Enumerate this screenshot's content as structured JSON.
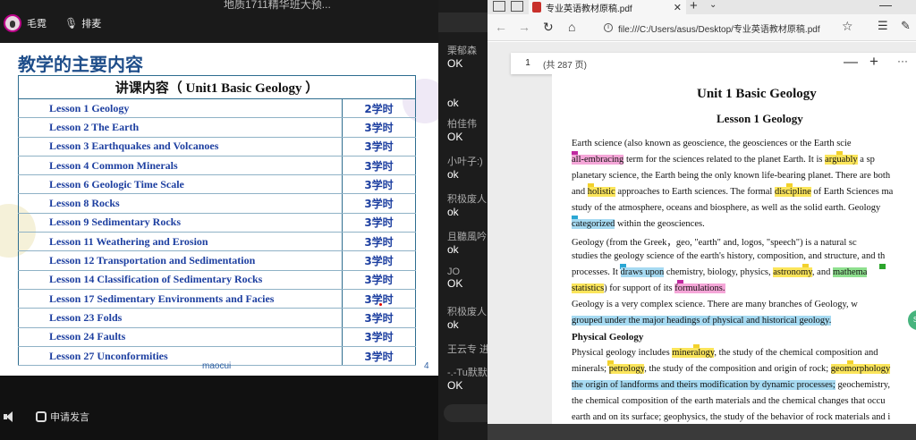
{
  "meeting": {
    "window_title": "地质1711精华班大预...",
    "host_name": "毛霓",
    "seat_label": "排麦",
    "bottom": {
      "apply_label": "申请发言"
    }
  },
  "slide": {
    "title": "教学的主要内容",
    "table_header": "讲课内容（ Unit1  Basic Geology  ）",
    "rows": [
      {
        "lesson": "Lesson 1   Geology",
        "hours": "2学时"
      },
      {
        "lesson": "Lesson 2   The Earth",
        "hours": "3学时"
      },
      {
        "lesson": "Lesson 3   Earthquakes and Volcanoes",
        "hours": "3学时"
      },
      {
        "lesson": "Lesson 4   Common Minerals",
        "hours": "3学时"
      },
      {
        "lesson": "Lesson 6   Geologic Time Scale",
        "hours": "3学时"
      },
      {
        "lesson": "Lesson 8   Rocks",
        "hours": "3学时"
      },
      {
        "lesson": "Lesson 9   Sedimentary Rocks",
        "hours": "3学时"
      },
      {
        "lesson": "Lesson 11 Weathering and Erosion",
        "hours": "3学时"
      },
      {
        "lesson": "Lesson 12  Transportation and Sedimentation",
        "hours": "3学时"
      },
      {
        "lesson": "Lesson 14  Classification of Sedimentary Rocks",
        "hours": "3学时"
      },
      {
        "lesson": "Lesson 17  Sedimentary Environments and Facies",
        "hours": "3学时"
      },
      {
        "lesson": "Lesson 23  Folds",
        "hours": "3学时"
      },
      {
        "lesson": "Lesson 24  Faults",
        "hours": "3学时"
      },
      {
        "lesson": "Lesson 27  Unconformities",
        "hours": "3学时"
      }
    ],
    "footer": "maocui",
    "page": "4"
  },
  "chat": [
    {
      "name": "栗郁森",
      "msg": "OK"
    },
    {
      "name": "",
      "msg": "ok"
    },
    {
      "name": "柏佳伟",
      "msg": "OK"
    },
    {
      "name": "小叶子:)",
      "msg": "ok"
    },
    {
      "name": "积极废人",
      "msg": "ok"
    },
    {
      "name": "且聽風吟",
      "msg": "ok"
    },
    {
      "name": "JO",
      "msg": "OK"
    },
    {
      "name": "积极废人",
      "msg": "ok"
    },
    {
      "name": "王云专 进",
      "msg": ""
    },
    {
      "name": "-.-Tu默默",
      "msg": "OK"
    }
  ],
  "browser": {
    "tab_title": "专业英语教材原稿.pdf",
    "url": "file:///C:/Users/asus/Desktop/专业英语教材原稿.pdf",
    "pdf_page": "1",
    "pdf_total": "(共 287 页)"
  },
  "doc": {
    "h1": "Unit 1    Basic Geology",
    "h2": "Lesson 1    Geology",
    "physical_heading": "Physical Geology",
    "l01": "      Earth science (also known as geoscience, the geosciences or the Earth scie",
    "l02a": "all-embracing",
    "l02b": " term for the sciences related to the planet Earth. It is ",
    "l02c": "arguably",
    "l02d": " a sp",
    "l03": "planetary science, the Earth being the only known life-bearing planet. There are both",
    "l04a": "and ",
    "l04b": "holistic",
    "l04c": " approaches to Earth sciences. The formal ",
    "l04d": "discipline",
    "l04e": " of Earth Sciences ma",
    "l05": "study of the atmosphere, oceans and biosphere, as well as the solid earth. Geology",
    "l06a": "categorized",
    "l06b": " within the geosciences.",
    "l07": "      Geology (from the Greek，geo, \"earth\" and, logos, \"speech\") is a natural sc",
    "l08": "studies the geology science of the earth's history, composition, and structure, and th",
    "l09a": "processes. It ",
    "l09b": "draws upon",
    "l09c": " chemistry, biology, physics, ",
    "l09d": "astronomy",
    "l09e": ", and ",
    "l09f": "mathema",
    "l10a": "statistics",
    "l10b": ") for support of its ",
    "l10c": "formulations.",
    "l11": "      Geology is a very complex science. There are many branches of Geology, w",
    "l12": "grouped under the major headings of physical and historical geology.",
    "l13a": "      Physical geology includes ",
    "l13b": "mineralogy",
    "l13c": ", the study of the chemical composition and",
    "l14a": "minerals; ",
    "l14b": "petrology",
    "l14c": ", the study of the composition and origin of rock; ",
    "l14d": "geomorphology",
    "l15": "the origin of landforms and theirs modification by dynamic processes;",
    "l15b": " geochemistry,",
    "l16": "the chemical composition of the earth materials and the chemical changes that occu",
    "l17": "earth and on its surface; geophysics, the study of the behavior of rock materials and i"
  }
}
